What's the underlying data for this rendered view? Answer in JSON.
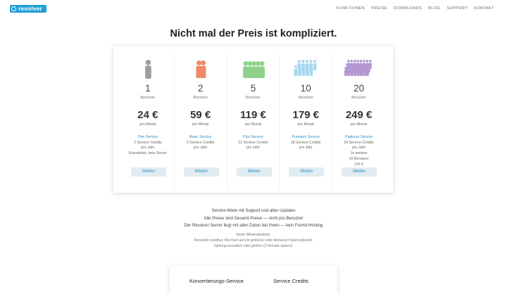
{
  "brand": {
    "name": "revolver",
    "color": "#1e9fd6"
  },
  "nav": [
    "FUNKTIONEN",
    "PREISE",
    "DOWNLOADS",
    "BLOG",
    "SUPPORT",
    "KONTAKT"
  ],
  "headline": "Nicht mal der Preis ist kompliziert.",
  "plans": [
    {
      "users": "1",
      "users_label": "Benutzer",
      "price": "24 €",
      "price_label": "pro Monat",
      "service_name": "One Service",
      "service_lines": [
        "2 Service Credits",
        "pro Jahr",
        "Einzelplatz, kein Server"
      ],
      "button": "Mieten",
      "icon": "single-person-icon",
      "color": "#9e9e9e"
    },
    {
      "users": "2",
      "users_label": "Benutzer",
      "price": "59 €",
      "price_label": "pro Monat",
      "service_name": "Basic Service",
      "service_lines": [
        "6 Service Credits",
        "pro Jahr"
      ],
      "button": "Mieten",
      "icon": "two-people-icon",
      "color": "#ef8a66"
    },
    {
      "users": "5",
      "users_label": "Benutzer",
      "price": "119 €",
      "price_label": "pro Monat",
      "service_name": "Plus Service",
      "service_lines": [
        "12 Service Credits",
        "pro Jahr"
      ],
      "button": "Mieten",
      "icon": "five-people-icon",
      "color": "#8fd38b"
    },
    {
      "users": "10",
      "users_label": "Benutzer",
      "price": "179 €",
      "price_label": "pro Monat",
      "service_name": "Premium Service",
      "service_lines": [
        "18 Service Credits",
        "pro Jahr"
      ],
      "button": "Mieten",
      "icon": "ten-people-icon",
      "color": "#9ad2ee"
    },
    {
      "users": "20",
      "users_label": "Benutzer",
      "price": "249 €",
      "price_label": "pro Monat",
      "service_name": "Platinum Service",
      "service_lines": [
        "24 Service Credits",
        "pro Jahr",
        "Je weitere",
        "10 Benutzer",
        "125 €"
      ],
      "button": "Mieten",
      "icon": "twenty-people-icon",
      "color": "#a685c9"
    }
  ],
  "info": [
    "Service-Miete mit Support und allen Updates",
    "Alle Preise sind Gesamt-Preise — nicht pro Benutzer",
    "Der Revolver Server liegt mit allen Daten bei Ihnen — kein Fremd-Hosting"
  ],
  "notes": [
    "Keine Mindestlaufzeit.",
    "Monatlich kündbar. Wechsel auf ein größeres oder kleineres Paket jederzeit.",
    "Zahlung monatlich oder jährlich (2 Monate sparen)."
  ],
  "bottom_card": {
    "left_title": "Konvertierungs-Service",
    "right_title": "Service Credits"
  },
  "accent_color": "#2a8fc6"
}
